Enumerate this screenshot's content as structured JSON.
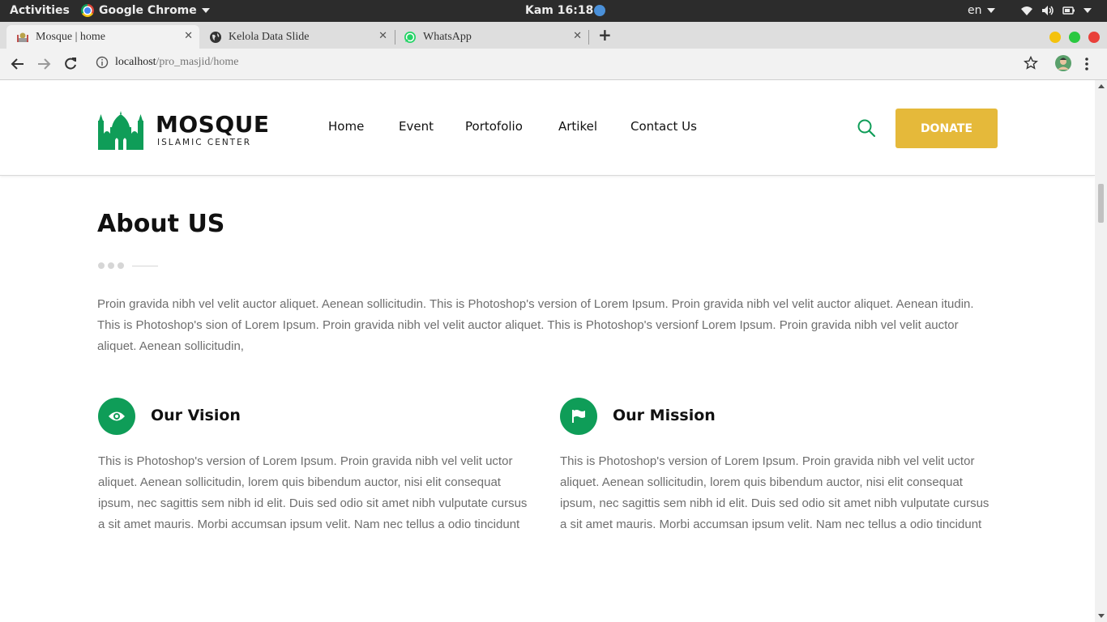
{
  "system_bar": {
    "activities": "Activities",
    "app_name": "Google Chrome",
    "clock": "Kam 16:18",
    "language": "en",
    "icons": [
      "wifi-icon",
      "volume-icon",
      "battery-icon",
      "power-menu-caret"
    ]
  },
  "browser": {
    "tabs": [
      {
        "title": "Mosque | home",
        "favicon": "mosque-favicon",
        "active": true
      },
      {
        "title": "Kelola Data Slide",
        "favicon": "globe-favicon",
        "active": false
      },
      {
        "title": "WhatsApp",
        "favicon": "whatsapp-favicon",
        "active": false
      }
    ],
    "url_host": "localhost",
    "url_path": "/pro_masjid/home",
    "window_controls": {
      "minimize": "#f4c20d",
      "maximize": "#2ac840",
      "close": "#e9403a"
    }
  },
  "site": {
    "logo_title": "MOSQUE",
    "logo_subtitle": "ISLAMIC CENTER",
    "nav": [
      "Home",
      "Event",
      "Portofolio",
      "Artikel",
      "Contact Us"
    ],
    "donate_label": "DONATE",
    "colors": {
      "brand_green": "#0f9d58",
      "donate_yellow": "#e5b93a"
    }
  },
  "about": {
    "title": "About US",
    "text": "Proin gravida nibh vel velit auctor aliquet. Aenean sollicitudin. This is Photoshop's version of Lorem Ipsum. Proin gravida nibh vel velit auctor aliquet. Aenean itudin. This is Photoshop's sion of Lorem Ipsum. Proin gravida nibh vel velit auctor aliquet. This is Photoshop's versionf Lorem Ipsum. Proin gravida nibh vel velit auctor aliquet. Aenean sollicitudin,"
  },
  "vision": {
    "title": "Our Vision",
    "icon": "eye-icon",
    "text": "This is Photoshop's version of Lorem Ipsum. Proin gravida nibh vel velit uctor aliquet. Aenean sollicitudin, lorem quis bibendum auctor, nisi elit consequat ipsum, nec sagittis sem nibh id elit. Duis sed odio sit amet nibh vulputate cursus a sit amet mauris. Morbi accumsan ipsum velit. Nam nec tellus a odio tincidunt"
  },
  "mission": {
    "title": "Our Mission",
    "icon": "flag-icon",
    "text": "This is Photoshop's version of Lorem Ipsum. Proin gravida nibh vel velit uctor aliquet. Aenean sollicitudin, lorem quis bibendum auctor, nisi elit consequat ipsum, nec sagittis sem nibh id elit. Duis sed odio sit amet nibh vulputate cursus a sit amet mauris. Morbi accumsan ipsum velit. Nam nec tellus a odio tincidunt"
  }
}
